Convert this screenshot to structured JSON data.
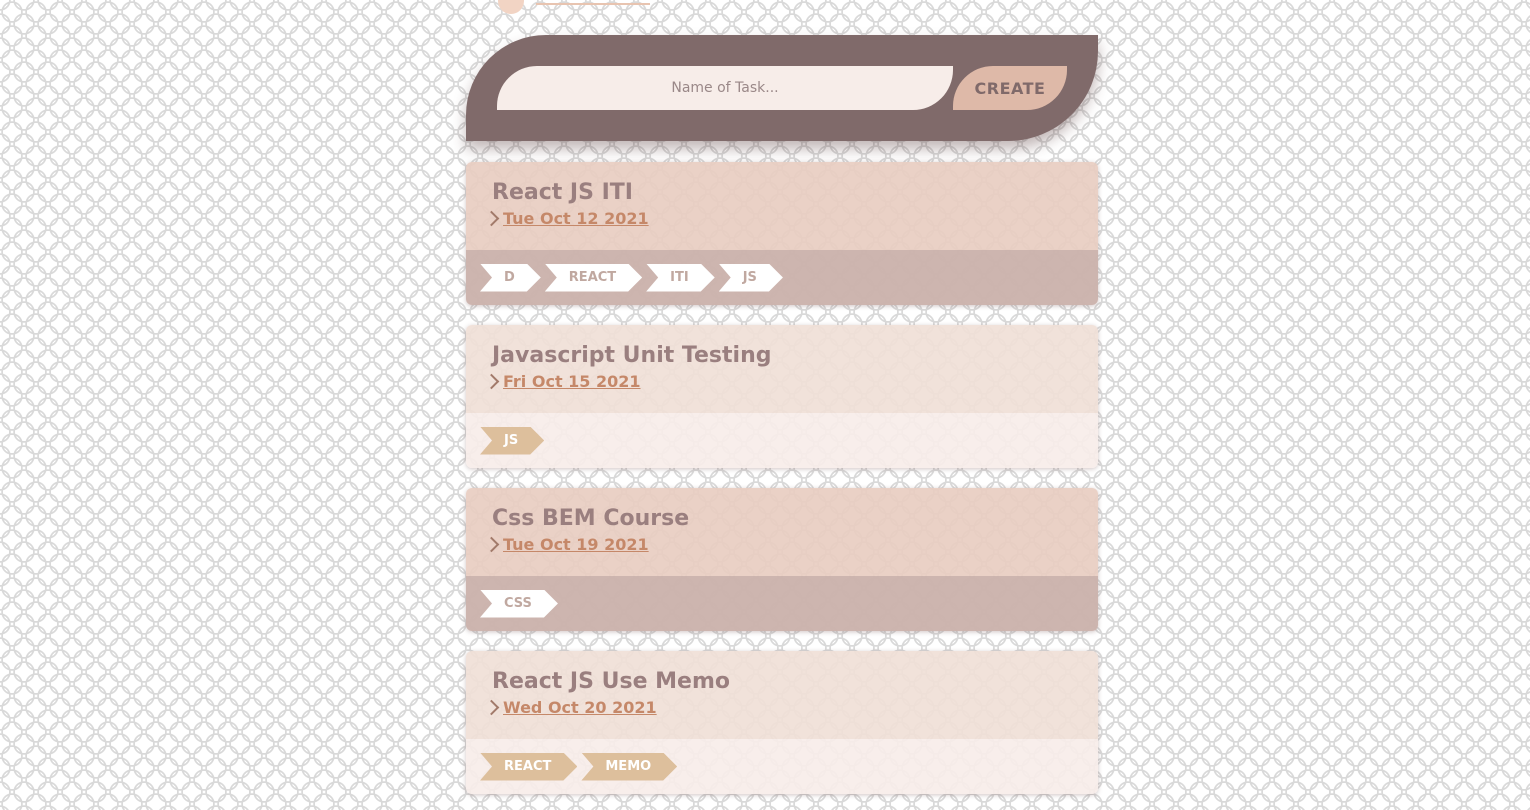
{
  "form": {
    "placeholder": "Name of Task...",
    "create_label": "CREATE"
  },
  "tasks": [
    {
      "title": "React JS ITI",
      "date": "Tue Oct 12 2021",
      "tags": [
        "D",
        "REACT",
        "ITI",
        "JS"
      ]
    },
    {
      "title": "Javascript Unit Testing",
      "date": "Fri Oct 15 2021",
      "tags": [
        "JS"
      ]
    },
    {
      "title": "Css BEM Course",
      "date": "Tue Oct 19 2021",
      "tags": [
        "CSS"
      ]
    },
    {
      "title": "React JS Use Memo",
      "date": "Wed Oct 20 2021",
      "tags": [
        "REACT",
        "MEMO"
      ]
    }
  ],
  "colors": {
    "form_bar": "#806a6a",
    "input_bg": "#f7ede9",
    "button_bg": "#deb9a8",
    "title_text": "#9a7f7f",
    "date_text": "#c58869"
  }
}
